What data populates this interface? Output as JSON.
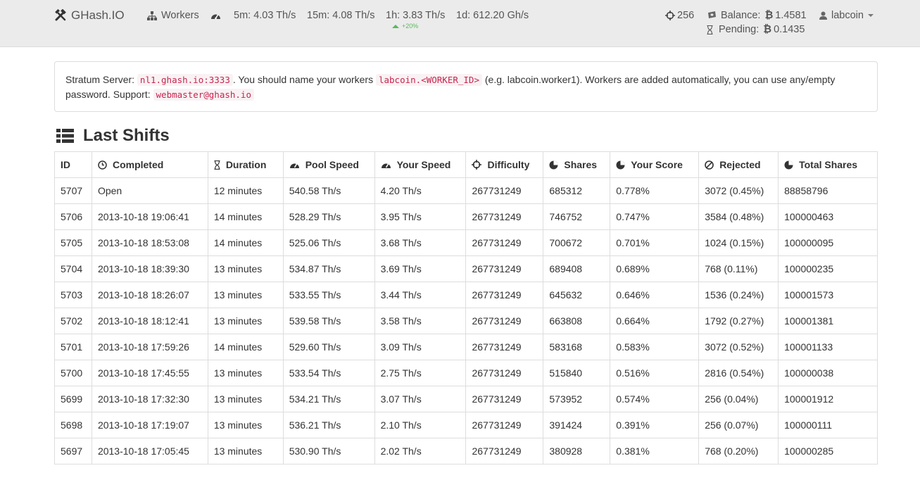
{
  "navbar": {
    "brand": "GHash.IO",
    "workers_label": "Workers",
    "speed_5m": "5m: 4.03 Th/s",
    "speed_15m": "15m: 4.08 Th/s",
    "speed_1h": "1h: 3.83 Th/s",
    "speed_1h_trend": "+20%",
    "speed_1d": "1d: 612.20 Gh/s",
    "worker_count": "256",
    "balance_label": "Balance:",
    "balance_value": "1.4581",
    "pending_label": "Pending:",
    "pending_value": "0.1435",
    "user": "labcoin",
    "trend_color": "#5cb85c"
  },
  "info": {
    "prefix": "Stratum Server:",
    "server": "nl1.ghash.io:3333",
    "middle": ". You should name your workers",
    "worker_pattern": "labcoin.<WORKER_ID>",
    "suffix": "(e.g. labcoin.worker1). Workers are added automatically, you can use any/empty password. Support:",
    "support_email": "webmaster@ghash.io"
  },
  "section": {
    "title": "Last Shifts"
  },
  "table": {
    "headers": [
      "ID",
      "Completed",
      "Duration",
      "Pool Speed",
      "Your Speed",
      "Difficulty",
      "Shares",
      "Your Score",
      "Rejected",
      "Total Shares"
    ],
    "rows": [
      [
        "5707",
        "Open",
        "12 minutes",
        "540.58 Th/s",
        "4.20 Th/s",
        "267731249",
        "685312",
        "0.778%",
        "3072 (0.45%)",
        "88858796"
      ],
      [
        "5706",
        "2013-10-18 19:06:41",
        "14 minutes",
        "528.29 Th/s",
        "3.95 Th/s",
        "267731249",
        "746752",
        "0.747%",
        "3584 (0.48%)",
        "100000463"
      ],
      [
        "5705",
        "2013-10-18 18:53:08",
        "14 minutes",
        "525.06 Th/s",
        "3.68 Th/s",
        "267731249",
        "700672",
        "0.701%",
        "1024 (0.15%)",
        "100000095"
      ],
      [
        "5704",
        "2013-10-18 18:39:30",
        "13 minutes",
        "534.87 Th/s",
        "3.69 Th/s",
        "267731249",
        "689408",
        "0.689%",
        "768 (0.11%)",
        "100000235"
      ],
      [
        "5703",
        "2013-10-18 18:26:07",
        "13 minutes",
        "533.55 Th/s",
        "3.44 Th/s",
        "267731249",
        "645632",
        "0.646%",
        "1536 (0.24%)",
        "100001573"
      ],
      [
        "5702",
        "2013-10-18 18:12:41",
        "13 minutes",
        "539.58 Th/s",
        "3.58 Th/s",
        "267731249",
        "663808",
        "0.664%",
        "1792 (0.27%)",
        "100001381"
      ],
      [
        "5701",
        "2013-10-18 17:59:26",
        "14 minutes",
        "529.60 Th/s",
        "3.09 Th/s",
        "267731249",
        "583168",
        "0.583%",
        "3072 (0.52%)",
        "100001133"
      ],
      [
        "5700",
        "2013-10-18 17:45:55",
        "13 minutes",
        "533.54 Th/s",
        "2.75 Th/s",
        "267731249",
        "515840",
        "0.516%",
        "2816 (0.54%)",
        "100000038"
      ],
      [
        "5699",
        "2013-10-18 17:32:30",
        "13 minutes",
        "534.21 Th/s",
        "3.07 Th/s",
        "267731249",
        "573952",
        "0.574%",
        "256 (0.04%)",
        "100001912"
      ],
      [
        "5698",
        "2013-10-18 17:19:07",
        "13 minutes",
        "536.21 Th/s",
        "2.10 Th/s",
        "267731249",
        "391424",
        "0.391%",
        "256 (0.07%)",
        "100000111"
      ],
      [
        "5697",
        "2013-10-18 17:05:45",
        "13 minutes",
        "530.90 Th/s",
        "2.02 Th/s",
        "267731249",
        "380928",
        "0.381%",
        "768 (0.20%)",
        "100000285"
      ]
    ]
  }
}
